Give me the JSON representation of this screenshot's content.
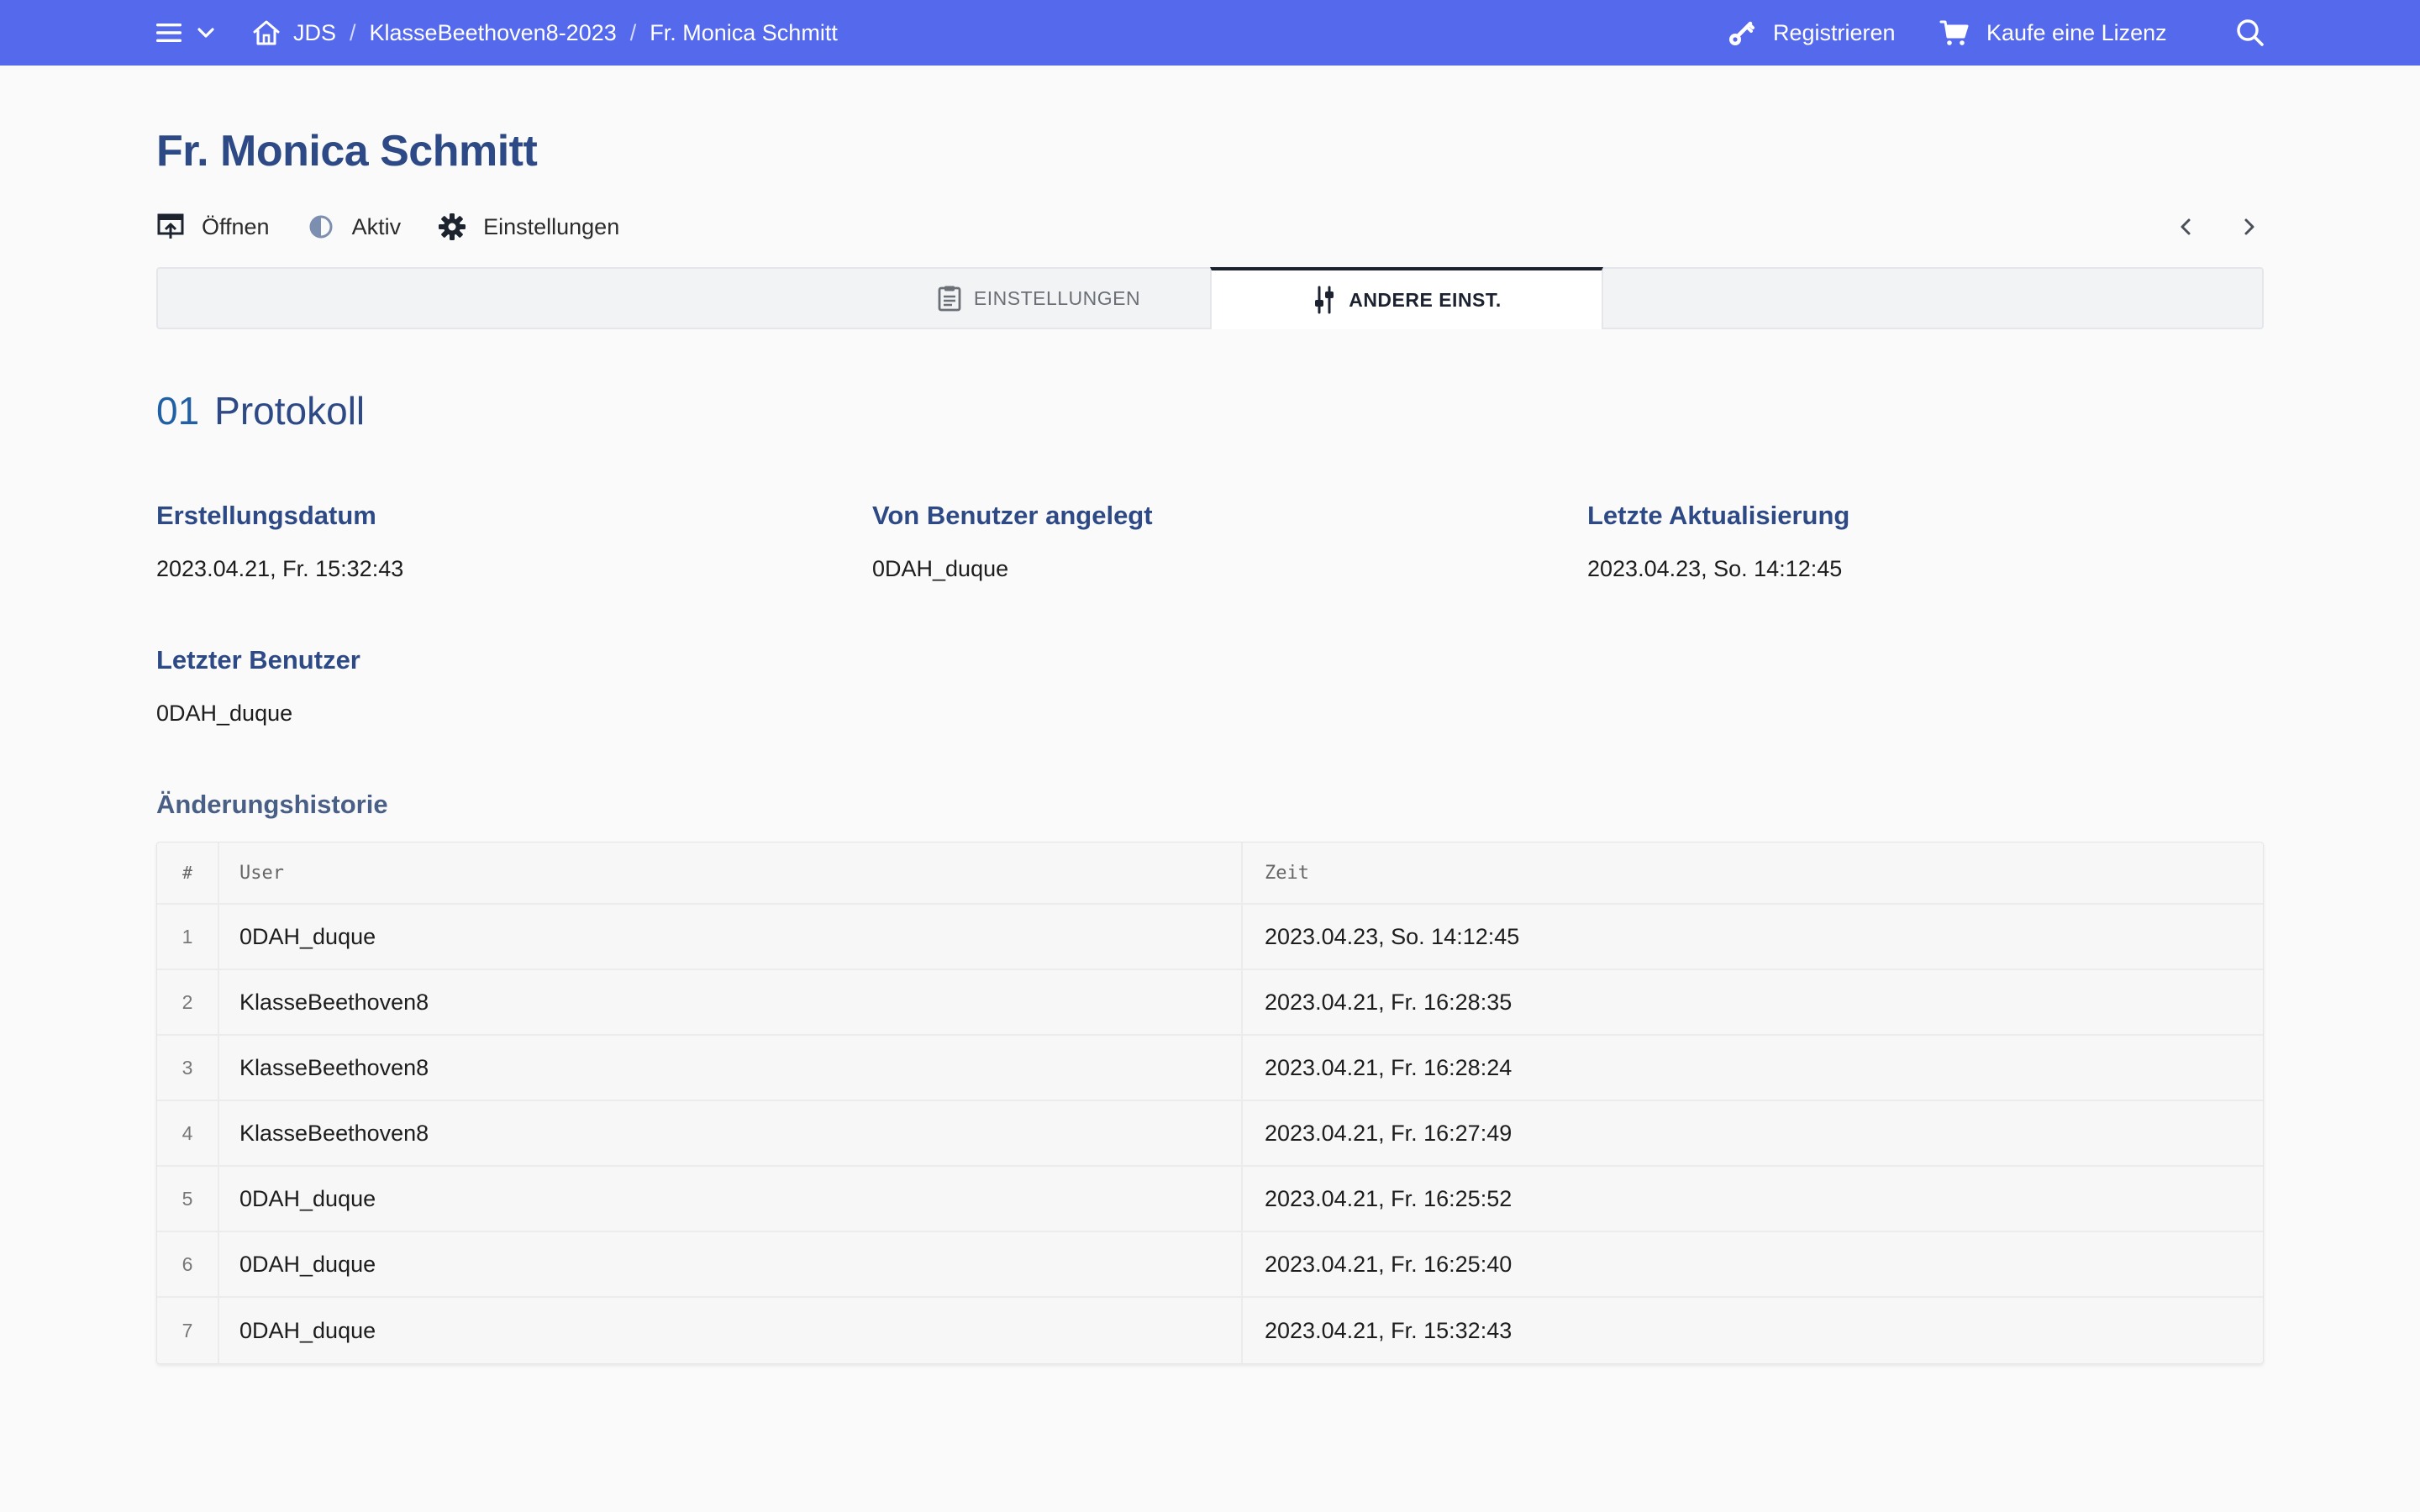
{
  "topbar": {
    "breadcrumb": [
      "JDS",
      "KlasseBeethoven8-2023",
      "Fr. Monica Schmitt"
    ],
    "separator": "/",
    "register_label": "Registrieren",
    "buy_label": "Kaufe eine Lizenz",
    "icons": [
      "menu-icon",
      "chevron-down-icon",
      "home-icon",
      "key-icon",
      "cart-icon",
      "search-icon"
    ],
    "bg_color": "#5569ec"
  },
  "page": {
    "title": "Fr. Monica Schmitt",
    "actions": [
      {
        "label": "Öffnen",
        "icon": "open-icon"
      },
      {
        "label": "Aktiv",
        "icon": "half-circle-icon"
      },
      {
        "label": "Einstellungen",
        "icon": "gear-icon"
      }
    ]
  },
  "tabs": [
    {
      "label": "EINSTELLUNGEN",
      "icon": "clipboard-icon",
      "active": false
    },
    {
      "label": "ANDERE EINST.",
      "icon": "sliders-icon",
      "active": true
    }
  ],
  "section": {
    "number": "01",
    "title": "Protokoll"
  },
  "fields": {
    "created_label": "Erstellungsdatum",
    "created_value": "2023.04.21, Fr. 15:32:43",
    "creator_label": "Von Benutzer angelegt",
    "creator_value": "0DAH_duque",
    "updated_label": "Letzte Aktualisierung",
    "updated_value": "2023.04.23, So. 14:12:45",
    "last_user_label": "Letzter Benutzer",
    "last_user_value": "0DAH_duque"
  },
  "history": {
    "title": "Änderungshistorie",
    "columns": [
      "#",
      "User",
      "Zeit"
    ],
    "rows": [
      {
        "num": "1",
        "user": "0DAH_duque",
        "time": "2023.04.23, So. 14:12:45"
      },
      {
        "num": "2",
        "user": "KlasseBeethoven8",
        "time": "2023.04.21, Fr. 16:28:35"
      },
      {
        "num": "3",
        "user": "KlasseBeethoven8",
        "time": "2023.04.21, Fr. 16:28:24"
      },
      {
        "num": "4",
        "user": "KlasseBeethoven8",
        "time": "2023.04.21, Fr. 16:27:49"
      },
      {
        "num": "5",
        "user": "0DAH_duque",
        "time": "2023.04.21, Fr. 16:25:52"
      },
      {
        "num": "6",
        "user": "0DAH_duque",
        "time": "2023.04.21, Fr. 16:25:40"
      },
      {
        "num": "7",
        "user": "0DAH_duque",
        "time": "2023.04.21, Fr. 15:32:43"
      }
    ]
  }
}
